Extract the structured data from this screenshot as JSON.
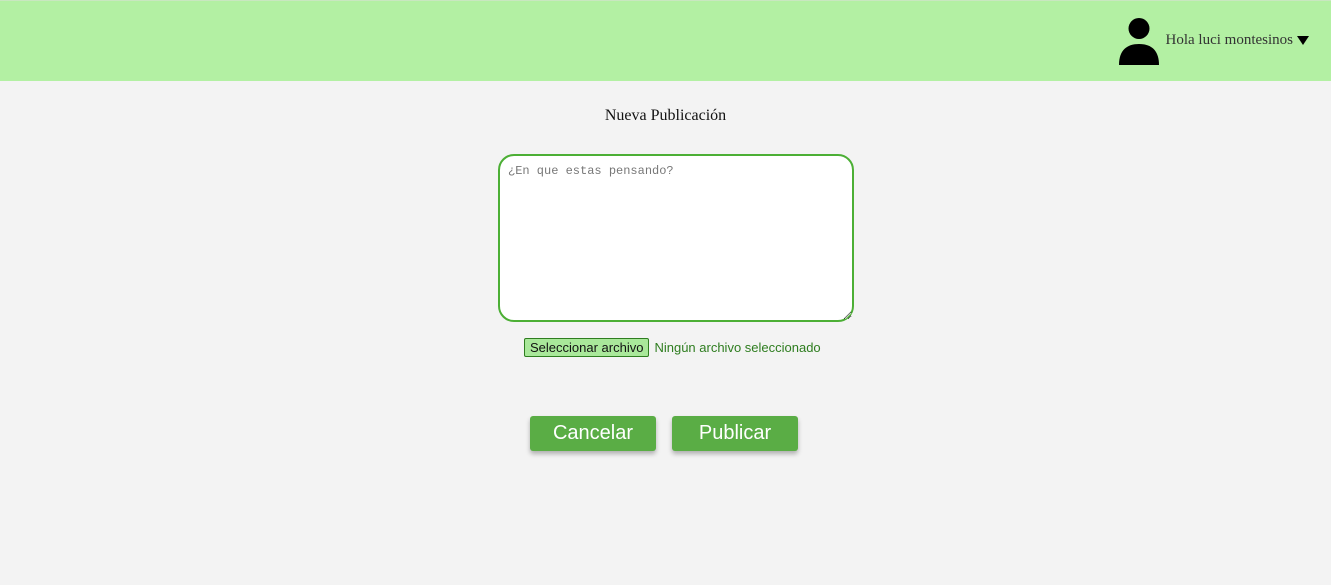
{
  "theme": {
    "header_bg": "#b3f0a3",
    "accent": "#5aad45",
    "border_green": "#4caf35",
    "link_green": "#2e7d1f",
    "page_bg": "#f3f3f3"
  },
  "header": {
    "avatar_icon": "user-silhouette-icon",
    "greeting": "Hola luci montesinos",
    "caret_icon": "caret-down-icon"
  },
  "main": {
    "title": "Nueva Publicación",
    "textarea": {
      "placeholder": "¿En que estas pensando?",
      "value": ""
    },
    "file_input": {
      "button_label": "Seleccionar archivo",
      "status": "Ningún archivo seleccionado"
    },
    "buttons": {
      "cancel_label": "Cancelar",
      "publish_label": "Publicar"
    }
  }
}
